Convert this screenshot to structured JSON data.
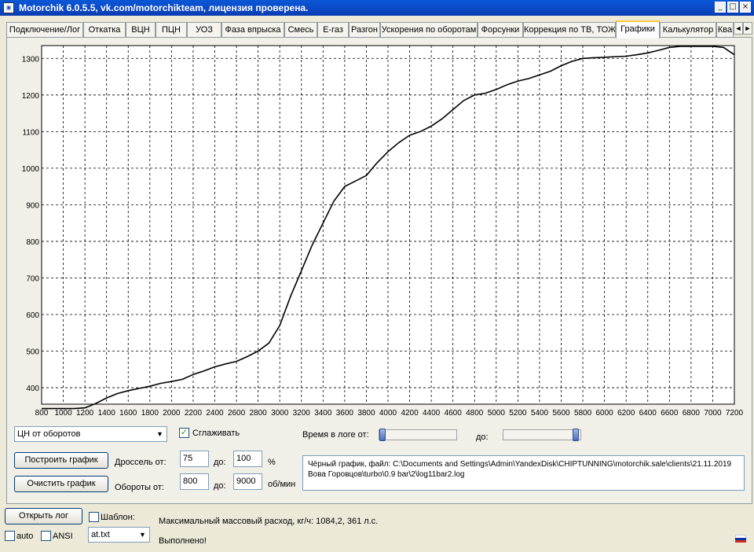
{
  "window": {
    "title": "Motorchik 6.0.5.5, vk.com/motorchikteam, лицензия проверена.",
    "buttons": [
      "_",
      "□",
      "×"
    ]
  },
  "tabs": [
    {
      "label": "Подключение/Лог"
    },
    {
      "label": "Откатка"
    },
    {
      "label": "ВЦН"
    },
    {
      "label": "ПЦН"
    },
    {
      "label": "УОЗ"
    },
    {
      "label": "Фаза впрыска"
    },
    {
      "label": "Смесь"
    },
    {
      "label": "Е-газ"
    },
    {
      "label": "Разгон"
    },
    {
      "label": "Ускорения по оборотам"
    },
    {
      "label": "Форсунки"
    },
    {
      "label": "Коррекция по ТВ, ТОЖ"
    },
    {
      "label": "Графики",
      "active": true
    },
    {
      "label": "Калькулятор"
    },
    {
      "label": "Ква"
    }
  ],
  "tab_scroll": {
    "left": "◄",
    "right": "►"
  },
  "chart_data": {
    "type": "line",
    "title": "",
    "xlabel": "",
    "ylabel": "",
    "xlim": [
      800,
      7200
    ],
    "ylim": [
      355,
      1335
    ],
    "grid": true,
    "x_ticks": [
      "800",
      "1000",
      "1200",
      "1400",
      "1600",
      "1800",
      "2000",
      "2200",
      "2400",
      "2600",
      "2800",
      "3000",
      "3200",
      "3400",
      "3600",
      "3800",
      "4000",
      "4200",
      "4400",
      "4600",
      "4800",
      "5000",
      "5200",
      "5400",
      "5600",
      "5800",
      "6000",
      "6200",
      "6400",
      "6600",
      "6800",
      "7000",
      "7200"
    ],
    "y_ticks": [
      "400",
      "500",
      "600",
      "700",
      "800",
      "900",
      "1000",
      "1100",
      "1200",
      "1300"
    ],
    "series": [
      {
        "color": "#000000",
        "x": [
          800,
          1000,
          1100,
          1200,
          1300,
          1400,
          1500,
          1600,
          1700,
          1800,
          1900,
          2000,
          2100,
          2200,
          2300,
          2400,
          2500,
          2600,
          2700,
          2800,
          2900,
          3000,
          3100,
          3200,
          3300,
          3400,
          3500,
          3600,
          3700,
          3800,
          3900,
          4000,
          4100,
          4200,
          4300,
          4400,
          4500,
          4600,
          4700,
          4800,
          4900,
          5000,
          5100,
          5200,
          5300,
          5400,
          5500,
          5600,
          5700,
          5800,
          5900,
          6000,
          6100,
          6200,
          6300,
          6400,
          6500,
          6600,
          6700,
          6800,
          6900,
          7000,
          7100,
          7200
        ],
        "y": [
          343,
          343,
          343,
          345,
          357,
          372,
          384,
          392,
          398,
          404,
          412,
          417,
          423,
          436,
          446,
          457,
          465,
          472,
          485,
          500,
          522,
          570,
          650,
          720,
          790,
          850,
          910,
          950,
          965,
          980,
          1015,
          1045,
          1070,
          1090,
          1100,
          1115,
          1135,
          1160,
          1185,
          1200,
          1205,
          1215,
          1228,
          1238,
          1245,
          1255,
          1265,
          1280,
          1292,
          1300,
          1302,
          1303,
          1305,
          1306,
          1310,
          1315,
          1322,
          1330,
          1333,
          1333,
          1333,
          1333,
          1330,
          1310
        ]
      }
    ]
  },
  "controls": {
    "graph_type": "ЦН от оборотов",
    "smooth_label": "Сглаживать",
    "smooth_checked": "✓",
    "build_button": "Построить график",
    "clear_button": "Очистить график",
    "throttle_from_label": "Дроссель от:",
    "throttle_from": "75",
    "throttle_to_label": "до:",
    "throttle_to": "100",
    "throttle_unit": "%",
    "rpm_from_label": "Обороты от:",
    "rpm_from": "800",
    "rpm_to_label": "до:",
    "rpm_to": "9000",
    "rpm_unit": "об/мин",
    "time_from_label": "Время в логе от:",
    "time_to_label": "до:",
    "time_from_fraction": 0.0,
    "time_to_fraction": 1.0
  },
  "info": {
    "line1": "Чёрный график, файл: C:\\Documents and Settings\\Admin\\YandexDisk\\CHIPTUNNING\\motorchik.sale\\clients\\21.11.2019",
    "line2": "Вова Горовцов\\turbo\\0.9 bar\\2\\log11bar2.log"
  },
  "bottom": {
    "open_log_button": "Открыть лог",
    "template_label": "Шаблон:",
    "auto_label": "auto",
    "ansi_label": "ANSI",
    "template_file": "at.txt",
    "max_flow": "Максимальный массовый расход, кг/ч: 1084,2, 361 л.с.",
    "status": "Выполнено!"
  },
  "colors": {
    "title_bar": "#0a47c4",
    "active_tab_accent": "#ffc83c",
    "plot_line": "#000000"
  }
}
